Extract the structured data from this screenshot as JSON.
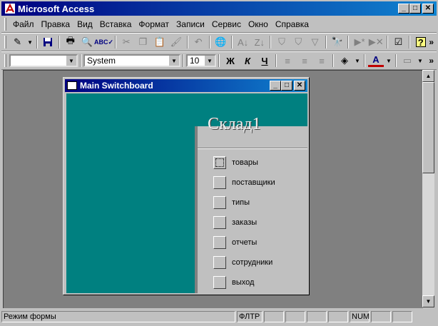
{
  "app": {
    "title": "Microsoft Access"
  },
  "menu": [
    {
      "label": "Файл"
    },
    {
      "label": "Правка"
    },
    {
      "label": "Вид"
    },
    {
      "label": "Вставка"
    },
    {
      "label": "Формат"
    },
    {
      "label": "Записи"
    },
    {
      "label": "Сервис"
    },
    {
      "label": "Окно"
    },
    {
      "label": "Справка"
    }
  ],
  "toolbar2": {
    "object_value": "",
    "font_value": "System",
    "size_value": "10",
    "bold_glyph": "Ж",
    "italic_glyph": "К",
    "underline_glyph": "Ч"
  },
  "child": {
    "title": "Main Switchboard"
  },
  "switchboard": {
    "heading": "Склад1",
    "options": [
      {
        "label": "товары"
      },
      {
        "label": "поставщики"
      },
      {
        "label": "типы"
      },
      {
        "label": "заказы"
      },
      {
        "label": "отчеты"
      },
      {
        "label": "сотрудники"
      },
      {
        "label": "выход"
      }
    ]
  },
  "status": {
    "message": "Режим формы",
    "filter": "ФЛТР",
    "num": "NUM"
  },
  "colors": {
    "title_start": "#000080",
    "title_end": "#1084d0",
    "form_bg": "#008080",
    "workspace": "#808080"
  },
  "icons": [
    "access-key-icon",
    "design-view-icon",
    "save-icon",
    "print-icon",
    "print-preview-icon",
    "spelling-icon",
    "cut-icon",
    "copy-icon",
    "paste-icon",
    "format-painter-icon",
    "undo-icon",
    "hyperlink-icon",
    "sort-asc-icon",
    "sort-desc-icon",
    "filter-selection-icon",
    "filter-form-icon",
    "apply-filter-icon",
    "find-icon",
    "new-record-icon",
    "delete-record-icon",
    "properties-icon",
    "help-icon"
  ]
}
